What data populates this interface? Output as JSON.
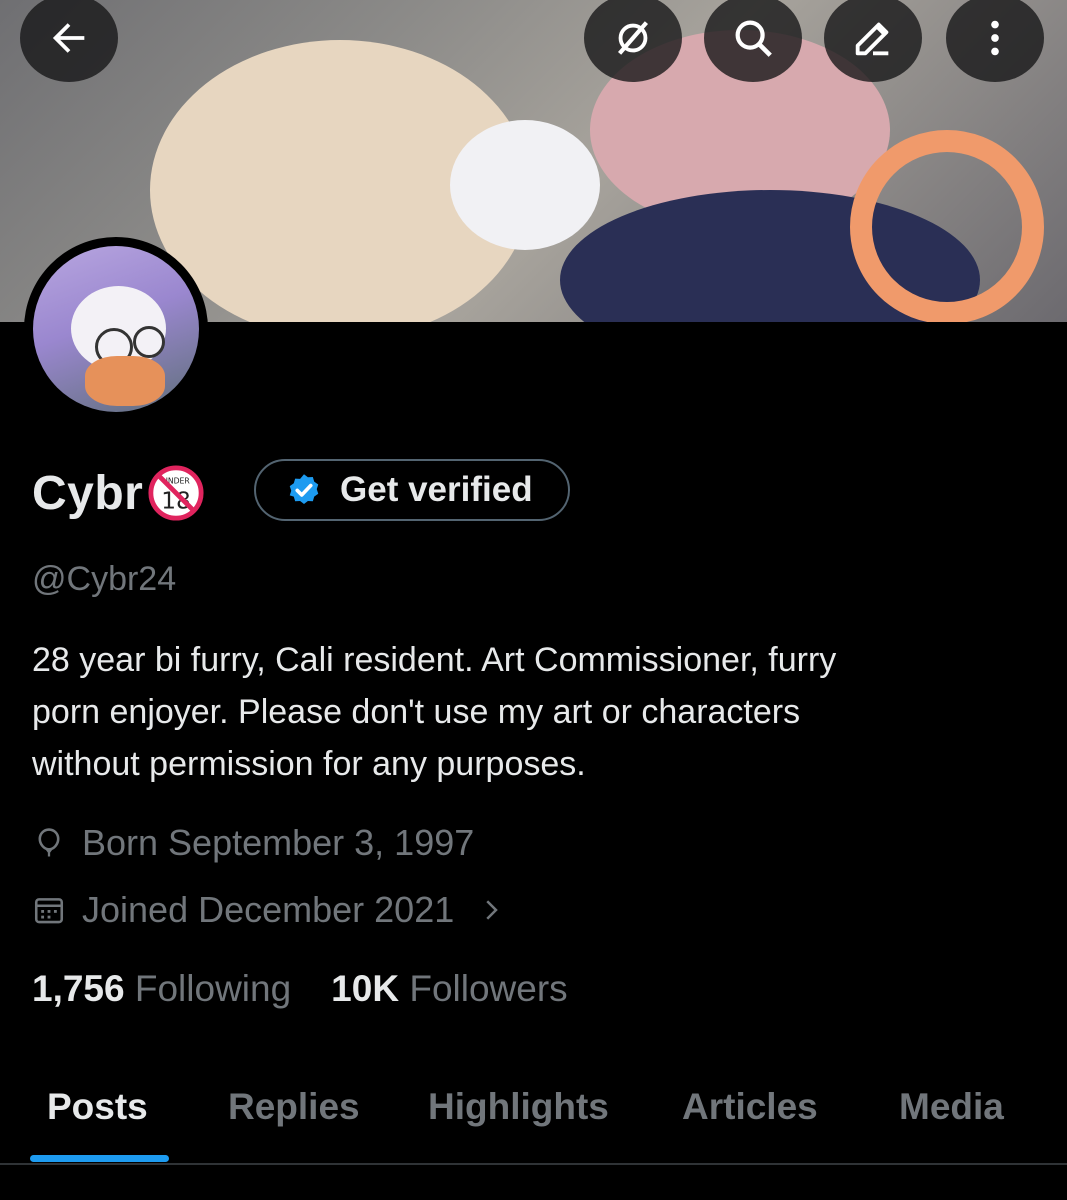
{
  "profile": {
    "display_name": "Cybr",
    "name_badge_text": "UNDER 18",
    "handle": "@Cybr24",
    "bio_lines": [
      "28 year bi furry, Cali resident. Art Commissioner, furry",
      "porn enjoyer.  Please don't use my art or characters",
      "without permission for any purposes."
    ],
    "birthday": "Born September 3, 1997",
    "joined": "Joined December 2021",
    "following_count": "1,756",
    "following_label": " Following",
    "followers_count": "10K",
    "followers_label": " Followers"
  },
  "verify_button": {
    "label": "Get verified"
  },
  "topbar": {
    "icons": [
      "back-arrow-icon",
      "grok-icon",
      "search-icon",
      "edit-icon",
      "more-icon"
    ]
  },
  "tabs": [
    {
      "label": "Posts",
      "active": true
    },
    {
      "label": "Replies",
      "active": false
    },
    {
      "label": "Highlights",
      "active": false
    },
    {
      "label": "Articles",
      "active": false
    },
    {
      "label": "Media",
      "active": false
    }
  ],
  "colors": {
    "background": "#000000",
    "text_primary": "#e7e9ea",
    "text_secondary": "#71767b",
    "accent": "#1d9bf0",
    "border": "#536471"
  }
}
